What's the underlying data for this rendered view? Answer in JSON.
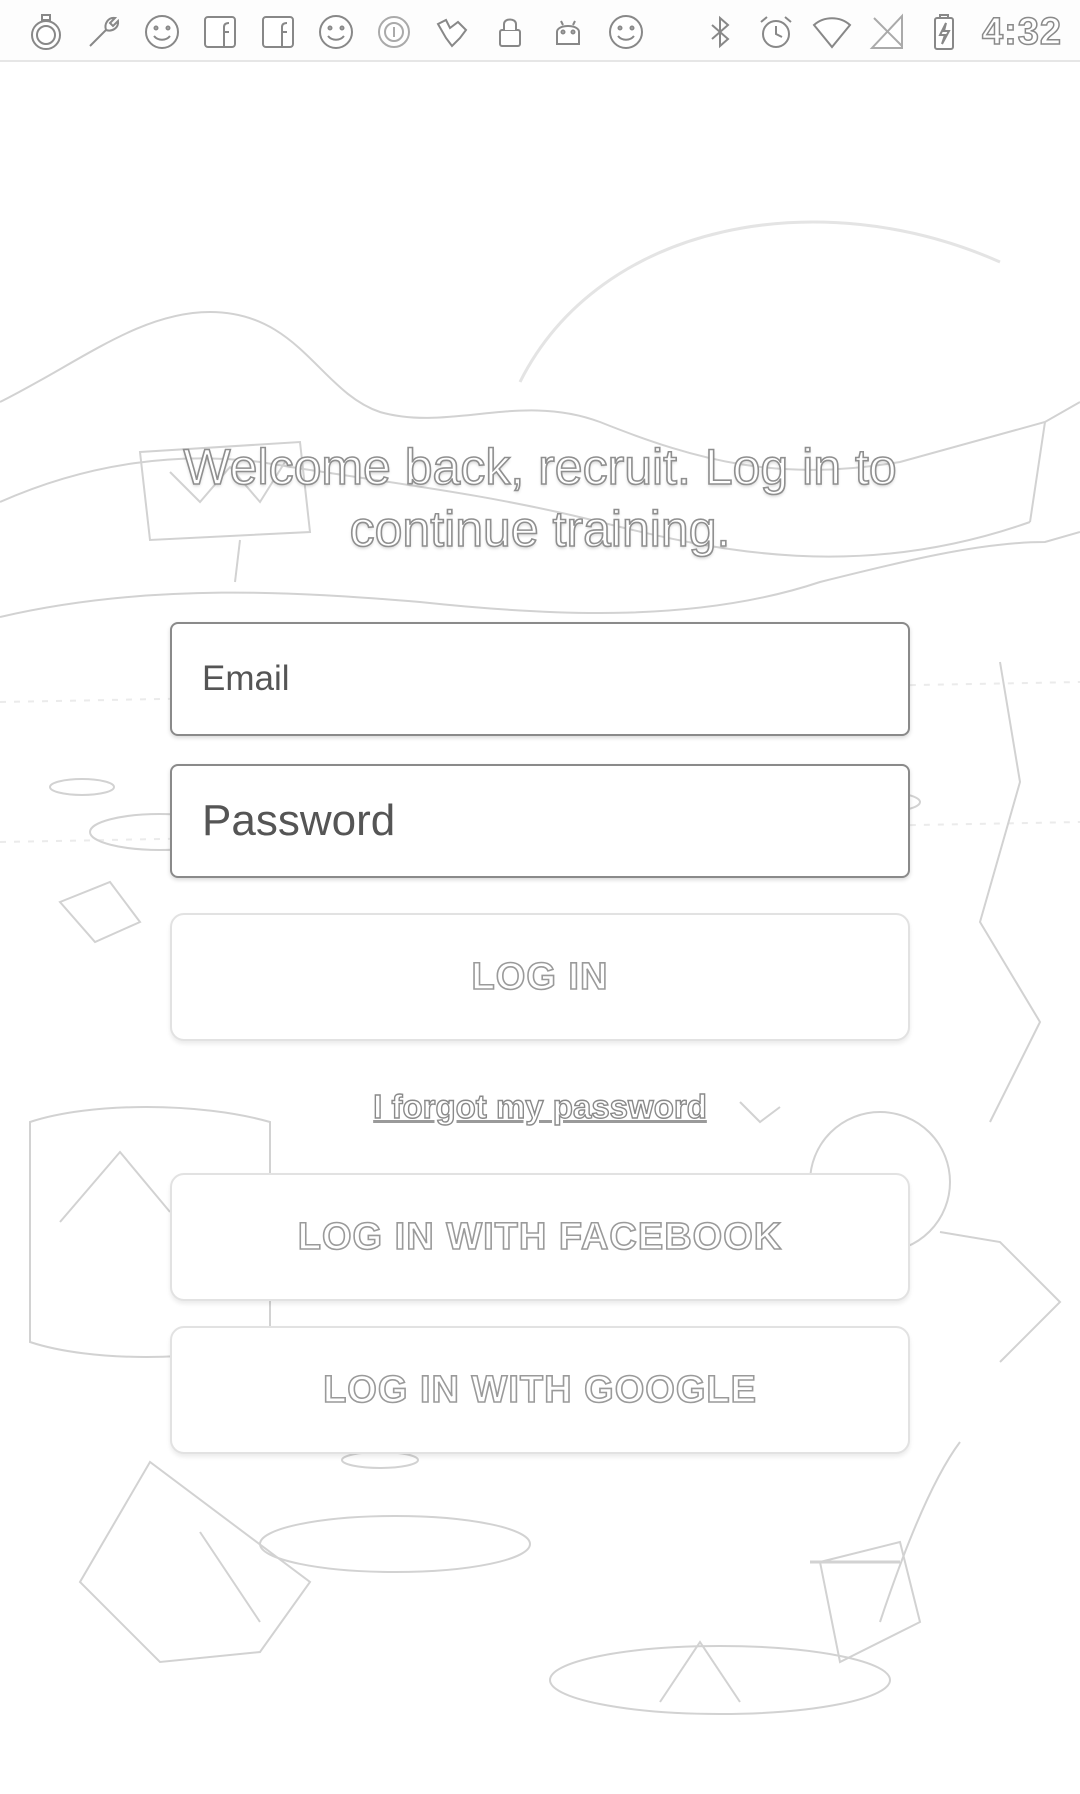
{
  "status_bar": {
    "time": "4:32",
    "left_icons": [
      "stopwatch-icon",
      "wrench-icon",
      "smiley-icon",
      "facebook-icon",
      "facebook-icon",
      "smiley-icon",
      "info-circle-icon",
      "signal-flair-icon",
      "lock-icon",
      "android-icon",
      "smiley-icon"
    ],
    "right_icons": [
      "bluetooth-icon",
      "alarm-icon",
      "wifi-icon",
      "no-sim-icon",
      "battery-charging-icon"
    ]
  },
  "login": {
    "welcome_text": "Welcome back, recruit. Log in to continue training.",
    "email_placeholder": "Email",
    "password_placeholder": "Password",
    "login_button": "LOG IN",
    "forgot_password_link": "I forgot my password",
    "facebook_button": "LOG IN WITH FACEBOOK",
    "google_button": "LOG IN WITH GOOGLE"
  },
  "colors": {
    "background": "#ffffff",
    "outline": "#8a8a8a",
    "art_line": "#cfcfcf"
  }
}
